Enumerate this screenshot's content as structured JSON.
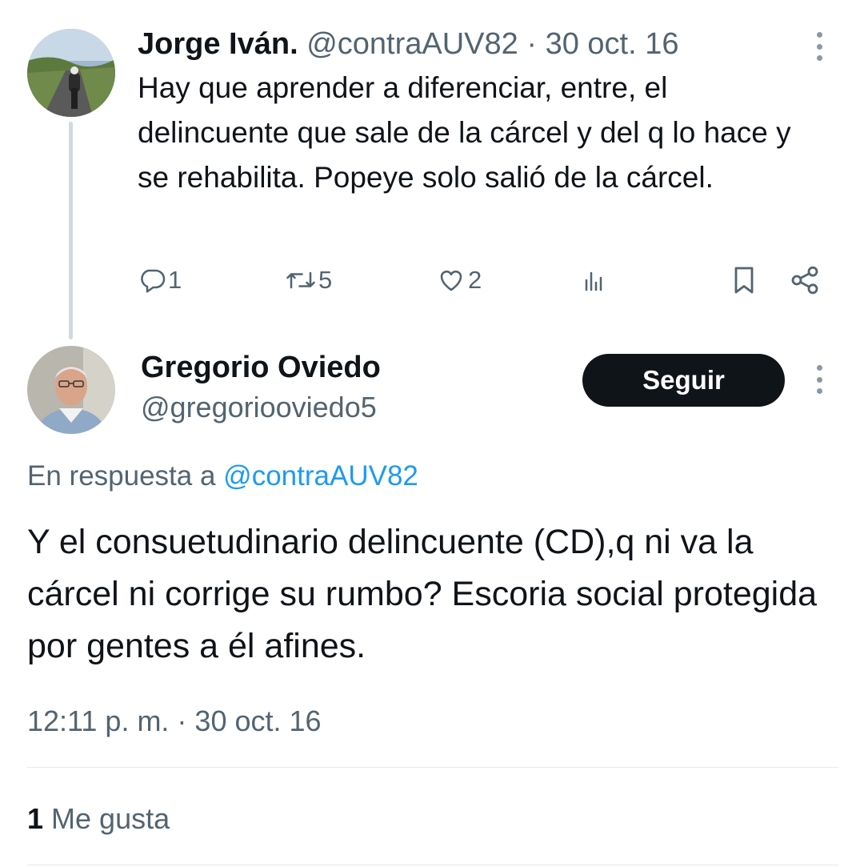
{
  "parent_tweet": {
    "author_name": "Jorge Iván.",
    "handle": "@contraAUV82",
    "separator": "·",
    "date": "30 oct. 16",
    "text": "Hay que aprender a diferenciar, entre, el delincuente que sale de la cárcel y del q lo hace y se rehabilita. Popeye solo salió de la cárcel.",
    "metrics": {
      "replies": "1",
      "retweets": "5",
      "likes": "2"
    },
    "icons": [
      "reply-icon",
      "retweet-icon",
      "like-icon",
      "views-icon",
      "bookmark-icon",
      "share-icon",
      "more-icon"
    ]
  },
  "reply_tweet": {
    "author_name": "Gregorio Oviedo",
    "handle": "@gregoriooviedo5",
    "follow_label": "Seguir",
    "reply_to_prefix": "En respuesta a",
    "reply_to_handle": "@contraAUV82",
    "text": "Y el consuetudinario delincuente (CD),q ni va la cárcel ni corrige su rumbo? Escoria social protegida por gentes a él afines.",
    "timestamp": "12:11 p. m. · 30 oct. 16",
    "likes_count": "1",
    "likes_label": "Me gusta"
  },
  "colors": {
    "text_primary": "#0f1419",
    "text_secondary": "#536471",
    "link": "#1d9bf0",
    "follow_button_bg": "#0f1419",
    "divider": "#e6e9eb"
  }
}
